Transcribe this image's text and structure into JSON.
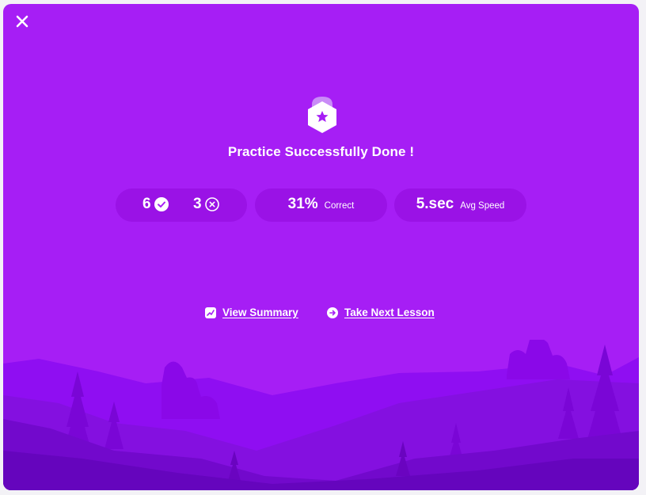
{
  "colors": {
    "card": "#a61ef5",
    "pill": "#9a12e6",
    "text": "#ffffff"
  },
  "header": {
    "close_icon": "close-icon"
  },
  "result": {
    "title": "Practice Successfully Done !",
    "badge_icon": "star-badge-icon"
  },
  "stats": {
    "correct_count": "6",
    "incorrect_count": "3",
    "percent_value": "31%",
    "percent_label": "Correct",
    "speed_value": "5.sec",
    "speed_label": "Avg Speed"
  },
  "actions": {
    "view_summary": "View Summary",
    "take_next_lesson": "Take Next Lesson"
  }
}
